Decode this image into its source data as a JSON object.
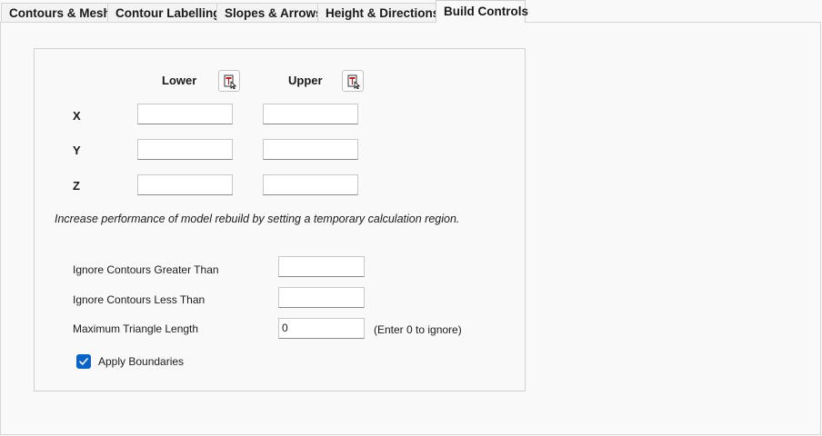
{
  "tabs": [
    {
      "label": "Contours & Mesh"
    },
    {
      "label": "Contour Labelling"
    },
    {
      "label": "Slopes & Arrows"
    },
    {
      "label": "Height & Directions"
    },
    {
      "label": "Build Controls"
    }
  ],
  "active_tab": "Build Controls",
  "region": {
    "lower_label": "Lower",
    "upper_label": "Upper",
    "pick_icon": "pick-point-icon",
    "rows": [
      {
        "label": "X",
        "lower": "",
        "upper": ""
      },
      {
        "label": "Y",
        "lower": "",
        "upper": ""
      },
      {
        "label": "Z",
        "lower": "",
        "upper": ""
      }
    ],
    "note": "Increase performance of model rebuild by setting a temporary calculation region."
  },
  "filters": {
    "greater_label": "Ignore Contours Greater Than",
    "greater_value": "",
    "less_label": "Ignore Contours Less Than",
    "less_value": "",
    "max_tri_label": "Maximum Triangle Length",
    "max_tri_value": "0",
    "max_tri_hint": "(Enter 0 to ignore)"
  },
  "apply_boundaries": {
    "label": "Apply Boundaries",
    "checked": true
  },
  "colors": {
    "accent": "#0a63c4",
    "background": "#f9f9f9"
  }
}
